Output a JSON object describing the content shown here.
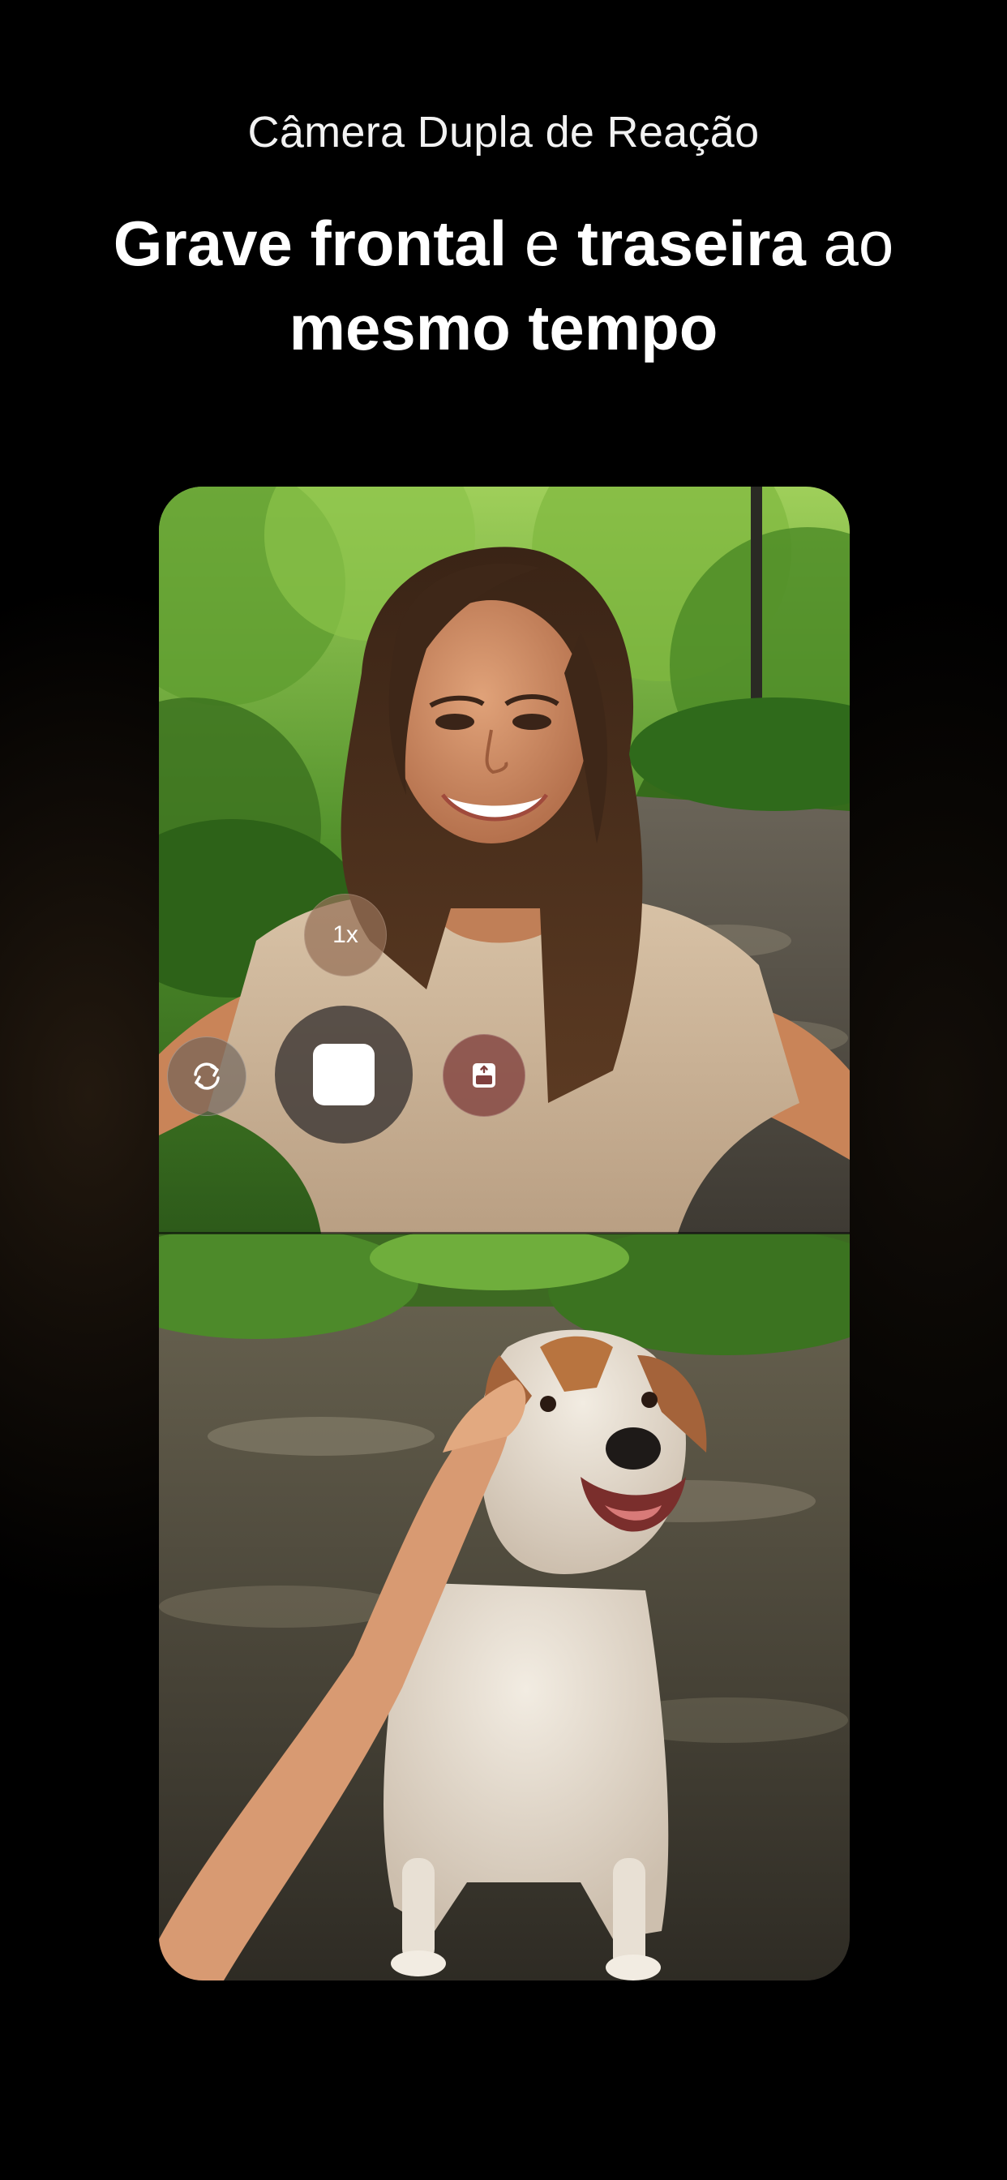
{
  "header": {
    "subtitle": "Câmera Dupla de Reação",
    "headline_part1": "Grave frontal",
    "headline_connector1": "e",
    "headline_part2": "traseira",
    "headline_connector2": "ao",
    "headline_part3": "mesmo tempo"
  },
  "preview": {
    "front_camera_scene": "woman-selfie-in-park",
    "rear_camera_scene": "dog-on-park-path"
  },
  "controls": {
    "zoom_label": "1x",
    "flip_icon": "camera-flip-icon",
    "record_icon": "stop-square-icon",
    "layout_icon": "layout-swap-icon"
  },
  "colors": {
    "background": "#000000",
    "text": "#ffffff",
    "record_stop": "#ffffff",
    "layout_button": "#80403e",
    "zoom_button": "#967058"
  }
}
